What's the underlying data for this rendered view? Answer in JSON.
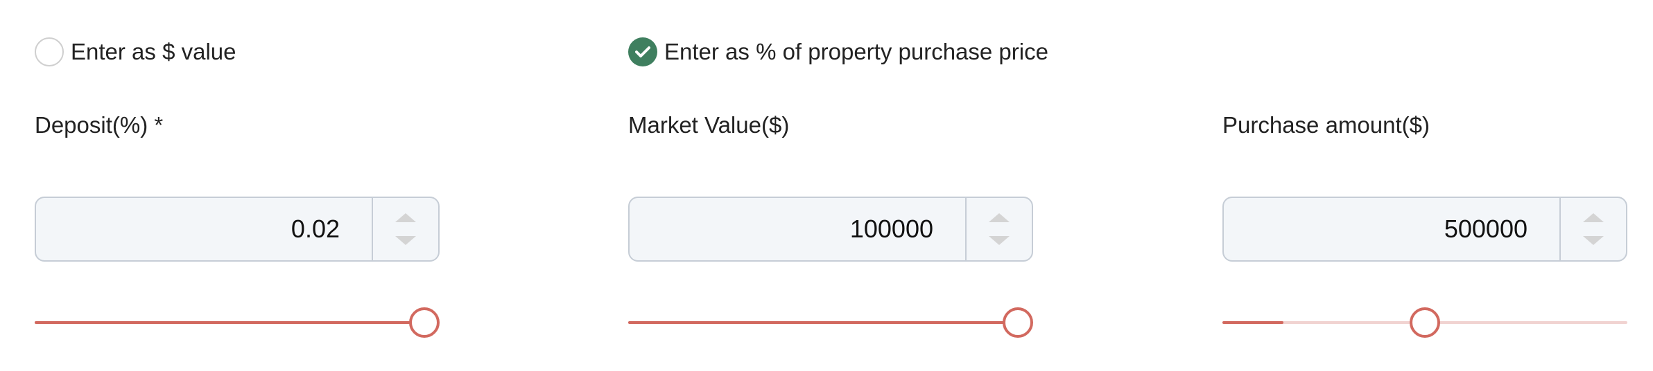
{
  "deposit_mode": {
    "options": [
      {
        "label": "Enter as $ value",
        "checked": false
      },
      {
        "label": "Enter as % of property purchase price",
        "checked": true
      }
    ]
  },
  "fields": [
    {
      "label": "Deposit(%) *",
      "value": "0.02",
      "slider_fraction": 1.0
    },
    {
      "label": "Market Value($)",
      "value": "100000",
      "slider_fraction": 1.0
    },
    {
      "label": "Purchase amount($)",
      "value": "500000",
      "slider_fraction": 0.5,
      "slider_fill_fraction": 0.15
    }
  ],
  "colors": {
    "accent": "#d2695f",
    "track": "#f1d3d1",
    "radio_checked": "#3f7f5f",
    "input_bg": "#f3f6f9",
    "input_border": "#c6cdd6"
  },
  "icons": {
    "checked_radio": "check-icon",
    "spinner_up": "chevron-up-icon",
    "spinner_down": "chevron-down-icon"
  }
}
